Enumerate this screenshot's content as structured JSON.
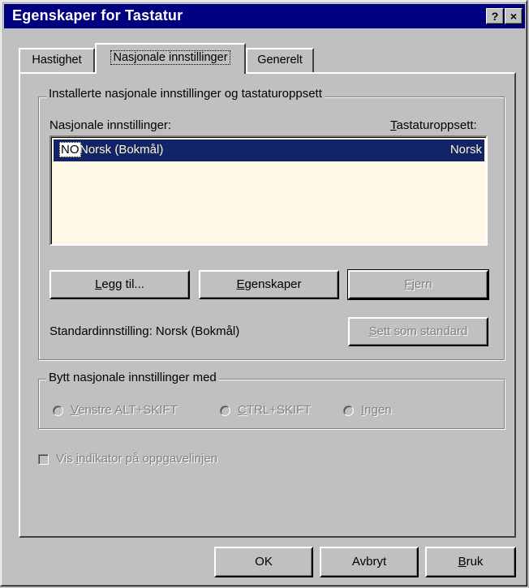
{
  "window": {
    "title": "Egenskaper for Tastatur",
    "help_button": "?",
    "close_button": "×"
  },
  "tabs": [
    {
      "label": "Hastighet"
    },
    {
      "label": "Nasjonale innstillinger"
    },
    {
      "label": "Generelt"
    }
  ],
  "installed_group": {
    "title": "Installerte nasjonale innstillinger og tastaturoppsett",
    "col_locale": "Nasjonale innstillinger:",
    "col_layout_first": "T",
    "col_layout_rest": "astaturoppsett:",
    "rows": [
      {
        "code": "NO",
        "name": "Norsk (Bokmål)",
        "layout": "Norsk"
      }
    ],
    "buttons": {
      "add_first": "L",
      "add_rest": "egg til...",
      "props_first": "E",
      "props_rest": "genskaper",
      "remove_first": "F",
      "remove_rest": "jern"
    },
    "default_text": "Standardinnstilling: Norsk (Bokmål)",
    "set_default_first": "S",
    "set_default_rest": "ett som standard"
  },
  "switch_group": {
    "title": "Bytt nasjonale innstillinger med",
    "options": [
      {
        "first": "V",
        "rest": "enstre ALT+SKIFT"
      },
      {
        "first": "C",
        "rest": "TRL+SKIFT"
      },
      {
        "first": "I",
        "rest": "ngen"
      }
    ]
  },
  "indicator": {
    "pre": "Vis ",
    "ul": "i",
    "post": "ndikator på oppgavelinjen"
  },
  "footer": {
    "ok": "OK",
    "cancel": "Avbryt",
    "apply_first": "B",
    "apply_rest": "ruk"
  }
}
